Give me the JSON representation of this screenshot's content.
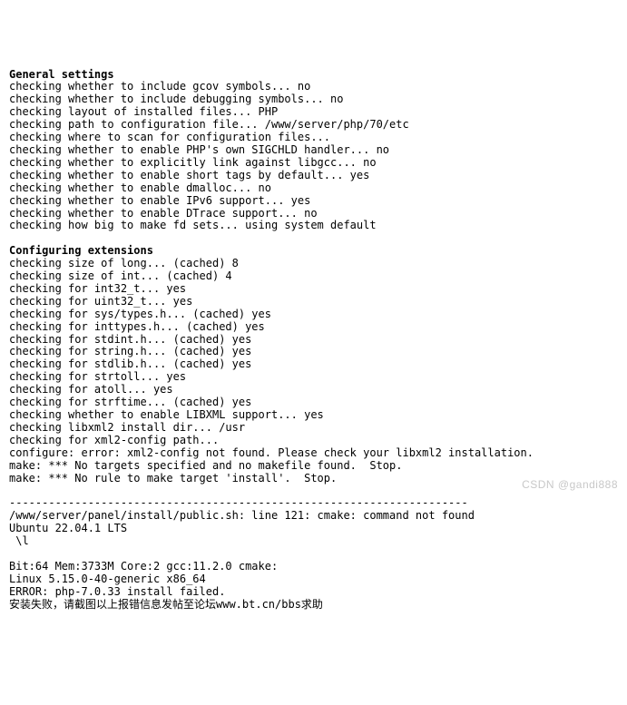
{
  "sections": {
    "general_settings": {
      "title": "General settings",
      "lines": [
        "checking whether to include gcov symbols... no",
        "checking whether to include debugging symbols... no",
        "checking layout of installed files... PHP",
        "checking path to configuration file... /www/server/php/70/etc",
        "checking where to scan for configuration files...",
        "checking whether to enable PHP's own SIGCHLD handler... no",
        "checking whether to explicitly link against libgcc... no",
        "checking whether to enable short tags by default... yes",
        "checking whether to enable dmalloc... no",
        "checking whether to enable IPv6 support... yes",
        "checking whether to enable DTrace support... no",
        "checking how big to make fd sets... using system default"
      ]
    },
    "configuring_extensions": {
      "title": "Configuring extensions",
      "lines": [
        "checking size of long... (cached) 8",
        "checking size of int... (cached) 4",
        "checking for int32_t... yes",
        "checking for uint32_t... yes",
        "checking for sys/types.h... (cached) yes",
        "checking for inttypes.h... (cached) yes",
        "checking for stdint.h... (cached) yes",
        "checking for string.h... (cached) yes",
        "checking for stdlib.h... (cached) yes",
        "checking for strtoll... yes",
        "checking for atoll... yes",
        "checking for strftime... (cached) yes",
        "checking whether to enable LIBXML support... yes",
        "checking libxml2 install dir... /usr",
        "checking for xml2-config path...",
        "configure: error: xml2-config not found. Please check your libxml2 installation.",
        "make: *** No targets specified and no makefile found.  Stop.",
        "make: *** No rule to make target 'install'.  Stop."
      ]
    }
  },
  "separator": "----------------------------------------------------------------------",
  "footer_lines": [
    "/www/server/panel/install/public.sh: line 121: cmake: command not found",
    "Ubuntu 22.04.1 LTS",
    " \\l",
    "",
    "Bit:64 Mem:3733M Core:2 gcc:11.2.0 cmake:",
    "Linux 5.15.0-40-generic x86_64",
    "ERROR: php-7.0.33 install failed.",
    "安装失败，请截图以上报错信息发帖至论坛www.bt.cn/bbs求助"
  ],
  "watermark": "CSDN @gandi888"
}
